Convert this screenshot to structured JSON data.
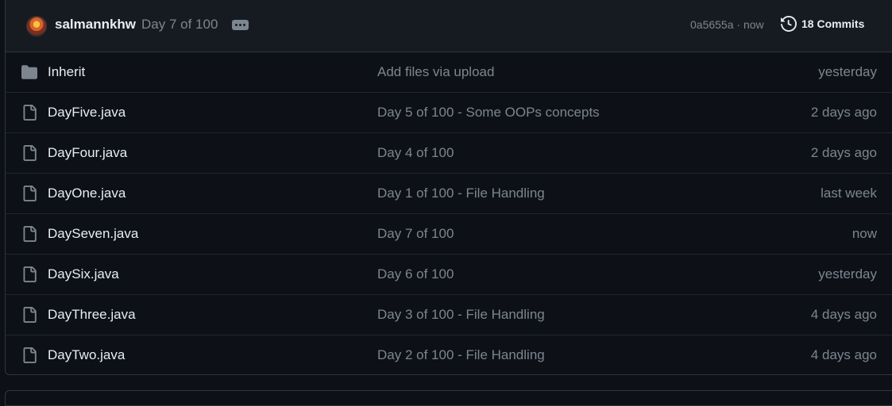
{
  "commit": {
    "author": "salmannkhw",
    "message": "Day 7 of 100",
    "meta": "0a5655a · now",
    "commits_label": "18 Commits"
  },
  "files": [
    {
      "type": "folder",
      "icon": "folder-icon",
      "name": "Inherit",
      "commit": "Add files via upload",
      "age": "yesterday"
    },
    {
      "type": "file",
      "icon": "file-icon",
      "name": "DayFive.java",
      "commit": "Day 5 of 100 - Some OOPs concepts",
      "age": "2 days ago"
    },
    {
      "type": "file",
      "icon": "file-icon",
      "name": "DayFour.java",
      "commit": "Day 4 of 100",
      "age": "2 days ago"
    },
    {
      "type": "file",
      "icon": "file-icon",
      "name": "DayOne.java",
      "commit": "Day 1 of 100 - File Handling",
      "age": "last week"
    },
    {
      "type": "file",
      "icon": "file-icon",
      "name": "DaySeven.java",
      "commit": "Day 7 of 100",
      "age": "now"
    },
    {
      "type": "file",
      "icon": "file-icon",
      "name": "DaySix.java",
      "commit": "Day 6 of 100",
      "age": "yesterday"
    },
    {
      "type": "file",
      "icon": "file-icon",
      "name": "DayThree.java",
      "commit": "Day 3 of 100 - File Handling",
      "age": "4 days ago"
    },
    {
      "type": "file",
      "icon": "file-icon",
      "name": "DayTwo.java",
      "commit": "Day 2 of 100 - File Handling",
      "age": "4 days ago"
    }
  ],
  "colors": {
    "background": "#0d1117",
    "header_bg": "#161b22",
    "border": "#30363d",
    "text": "#e6edf3",
    "muted": "#7d8590"
  }
}
